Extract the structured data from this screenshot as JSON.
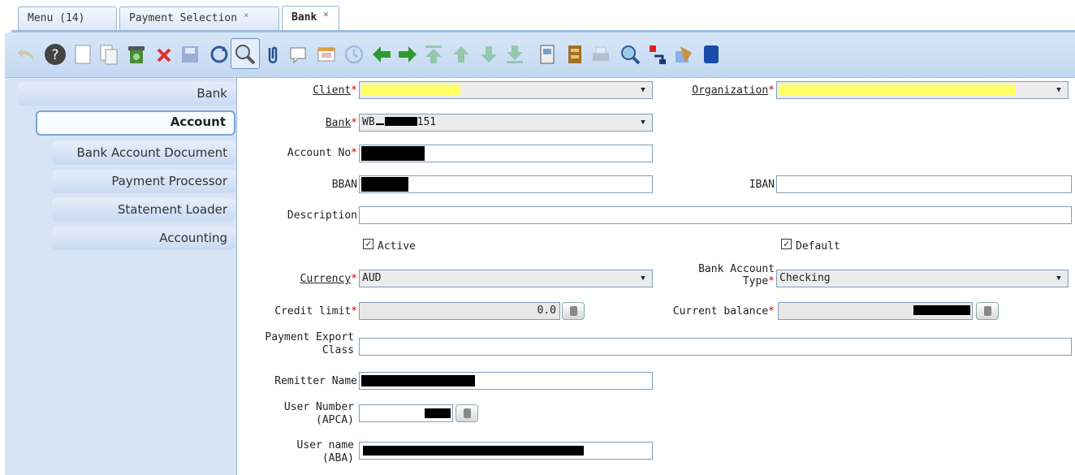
{
  "tabs": [
    {
      "label": "Menu (14)"
    },
    {
      "label": "Payment Selection",
      "close": "×"
    },
    {
      "label": "Bank",
      "close": "×"
    }
  ],
  "toolbar": {
    "buttons": [
      "undo-icon",
      "help-icon",
      "new-record-icon",
      "copy-record-icon",
      "delete-selected-icon",
      "delete-icon",
      "save-icon",
      "refresh-icon",
      "find-icon",
      "attachment-icon",
      "chat-icon",
      "grid-toggle-icon",
      "history-icon",
      "previous-record-icon",
      "next-record-icon",
      "first-record-icon",
      "parent-record-icon",
      "detail-record-icon",
      "last-record-icon",
      "report-icon",
      "archive-icon",
      "print-icon",
      "zoom-across-icon",
      "request-icon",
      "product-info-icon",
      "workflow-icon"
    ]
  },
  "leftnav": {
    "items": [
      "Bank",
      "Account",
      "Bank Account Document",
      "Payment Processor",
      "Statement Loader",
      "Accounting"
    ]
  },
  "form": {
    "client_label": "Client",
    "org_label": "Organization",
    "bank_label": "Bank",
    "bank_value_prefix": "WB",
    "bank_value_suffix": "151",
    "account_no_label": "Account No",
    "bban_label": "BBAN",
    "iban_label": "IBAN",
    "description_label": "Description",
    "active_label": "Active",
    "default_label": "Default",
    "check_mark": "✓",
    "currency_label": "Currency",
    "currency_value": "AUD",
    "account_type_label_1": "Bank Account",
    "account_type_label_2": "Type",
    "account_type_value": "Checking",
    "credit_limit_label": "Credit limit",
    "credit_limit_value": "0.0",
    "current_balance_label": "Current balance",
    "payment_export_label_1": "Payment Export",
    "payment_export_label_2": "Class",
    "remitter_label": "Remitter Name",
    "user_number_label_1": "User Number",
    "user_number_label_2": "(APCA)",
    "user_name_label_1": "User name",
    "user_name_label_2": "(ABA)",
    "required_mark": "*",
    "dropdown_arrow": "▼"
  },
  "colors": {
    "toolbar_bg": "#c8dbf2",
    "nav_bg": "#d6e4f6",
    "required": "#d00000",
    "highlight": "#ffff66"
  }
}
